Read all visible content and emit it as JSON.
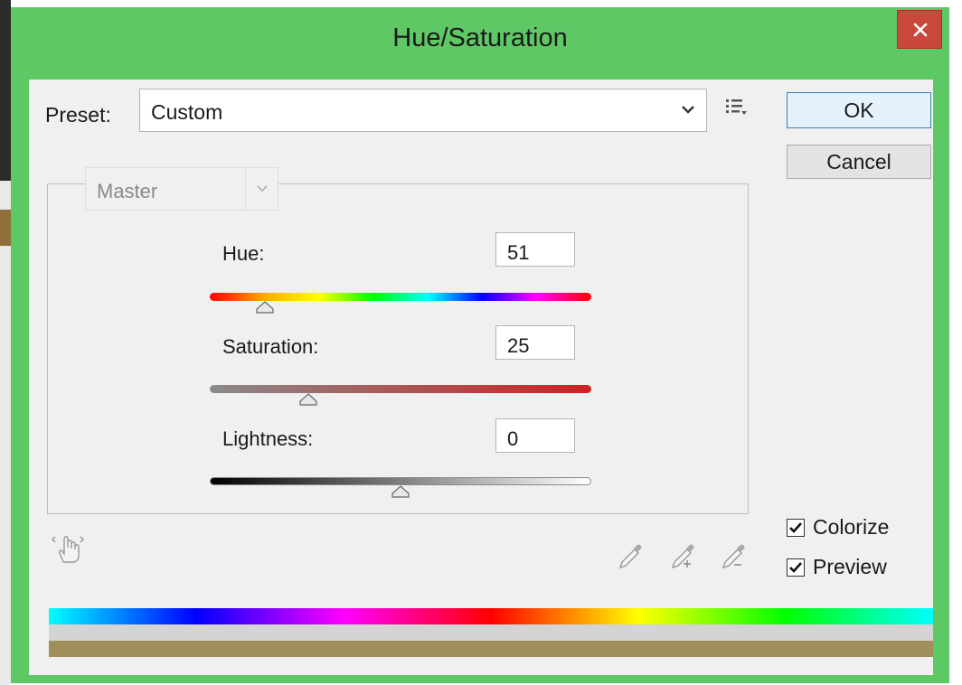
{
  "window": {
    "title": "Hue/Saturation",
    "frame_color": "#5ec864"
  },
  "preset": {
    "label": "Preset:",
    "value": "Custom"
  },
  "buttons": {
    "ok": "OK",
    "cancel": "Cancel"
  },
  "channel": {
    "value": "Master"
  },
  "sliders": {
    "hue": {
      "label": "Hue:",
      "value": "51"
    },
    "saturation": {
      "label": "Saturation:",
      "value": "25"
    },
    "lightness": {
      "label": "Lightness:",
      "value": "0"
    }
  },
  "checkboxes": {
    "colorize": {
      "label": "Colorize",
      "checked": true
    },
    "preview": {
      "label": "Preview",
      "checked": true
    }
  },
  "icons": {
    "close": "close-icon",
    "preset_menu": "preset-options-icon",
    "targeted_adjust": "hand-adjust-icon",
    "eyedroppers": [
      "eyedropper-icon",
      "eyedropper-plus-icon",
      "eyedropper-minus-icon"
    ]
  },
  "colors": {
    "result_bar": "#a08e5d"
  }
}
